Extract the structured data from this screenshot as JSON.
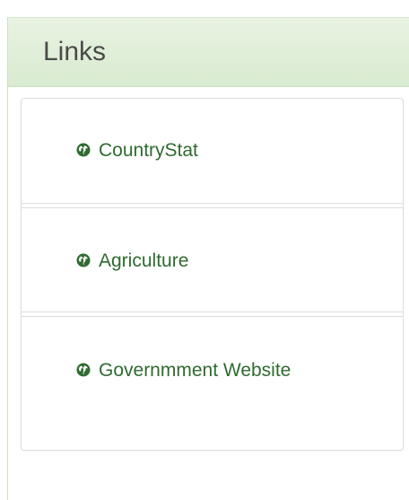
{
  "panel": {
    "title": "Links",
    "links": [
      {
        "label": "CountryStat",
        "icon": "globe-icon"
      },
      {
        "label": "Agriculture",
        "icon": "globe-icon"
      },
      {
        "label": "Governmment Website",
        "icon": "globe-icon"
      }
    ]
  },
  "colors": {
    "heading_background": "#dfeed8",
    "link_text": "#2f6b30",
    "title_text": "#4a4a4a",
    "border": "#dddddd"
  }
}
